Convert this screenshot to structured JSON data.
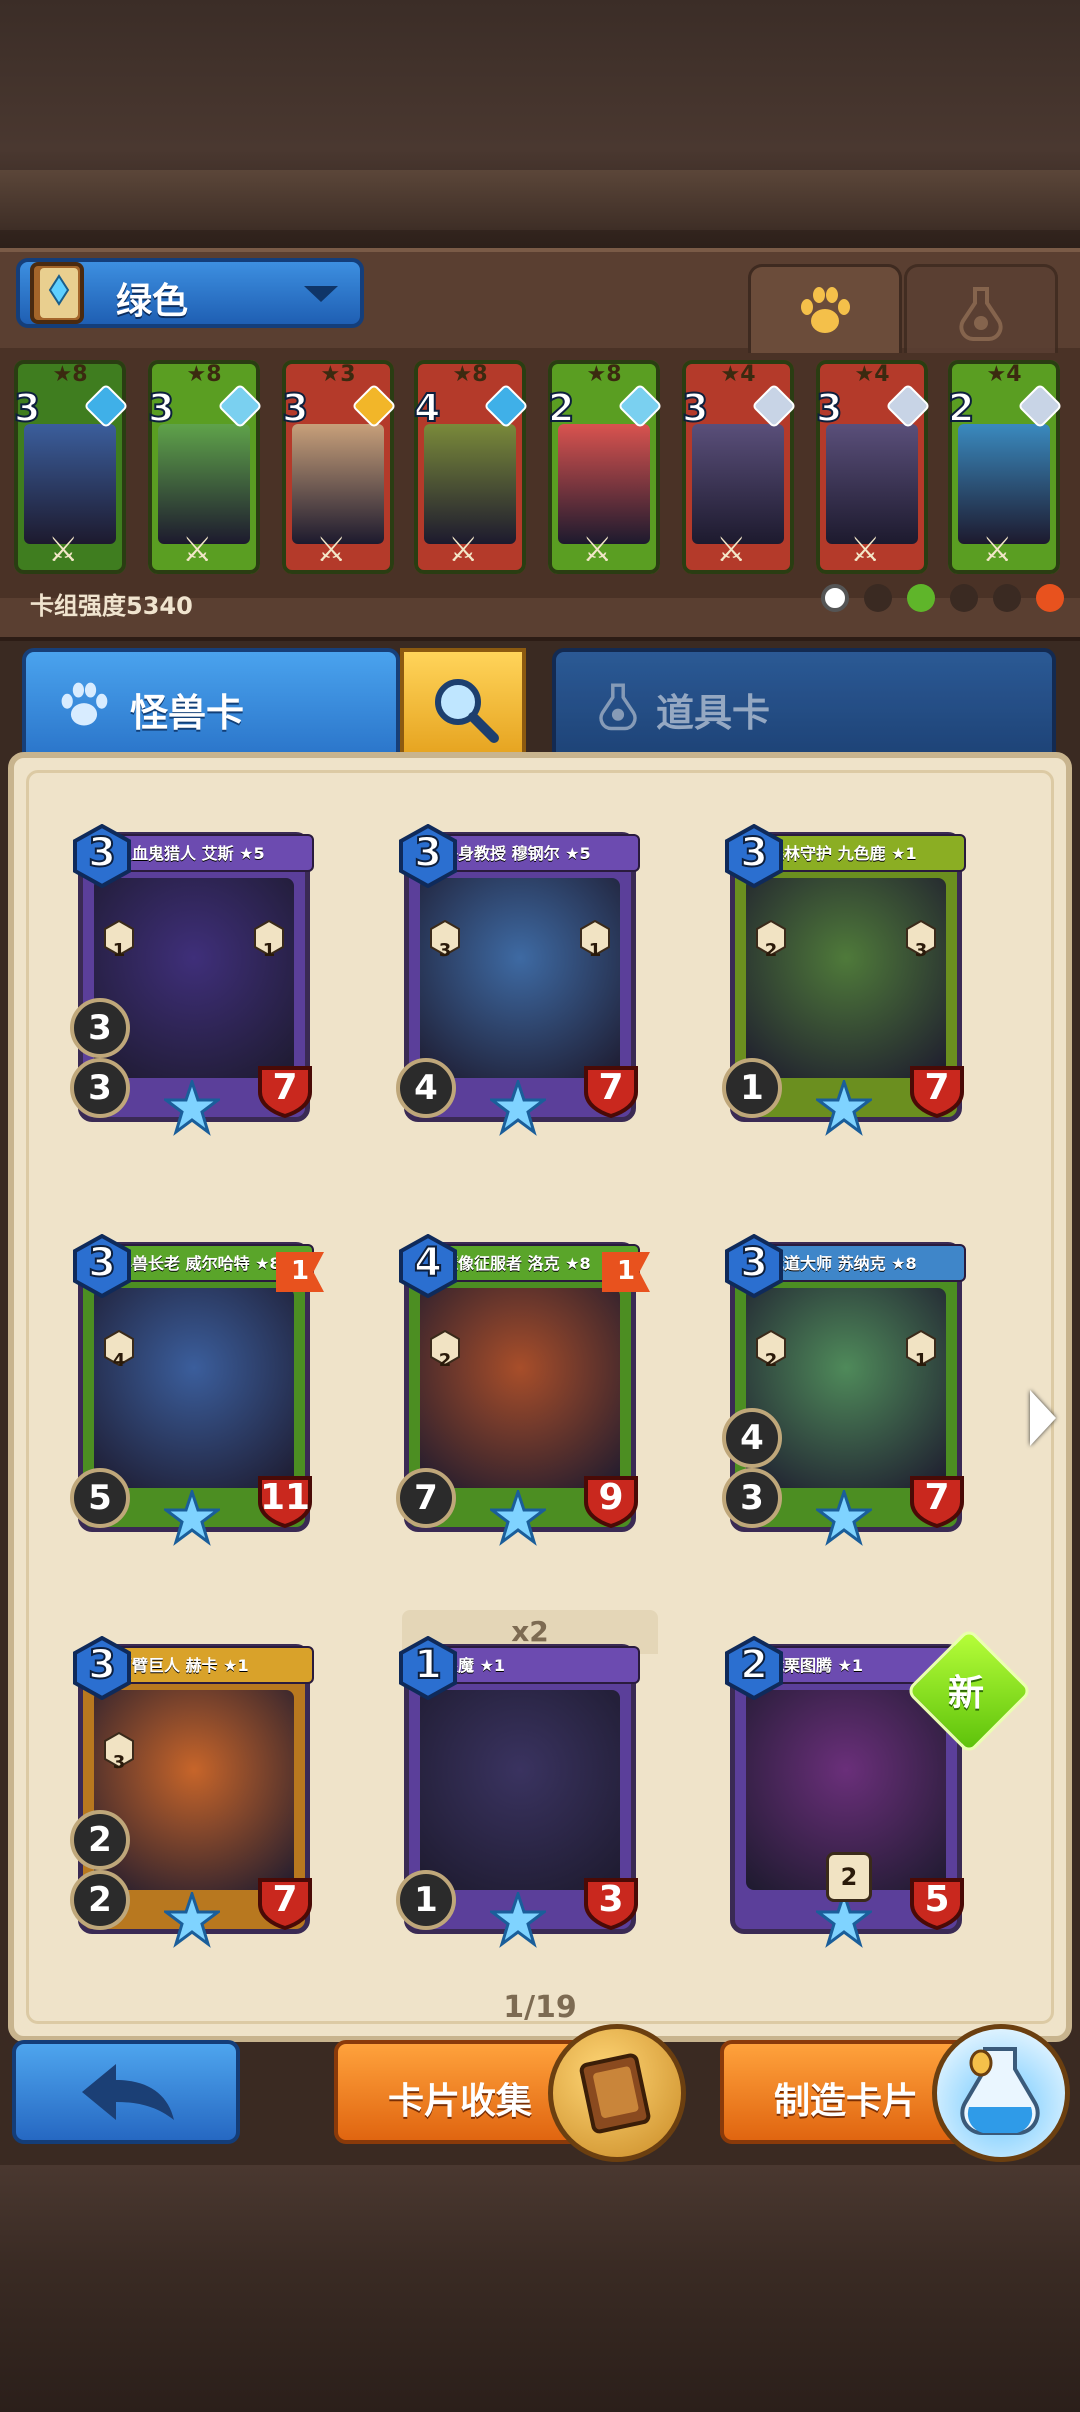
{
  "deck": {
    "selected_name": "绿色",
    "power_label": "卡组强度5340",
    "tabs": [
      "paw-icon",
      "potion-icon"
    ],
    "cards": [
      {
        "stars": "★8",
        "cost": "3",
        "gem_color": "#3fb0e8",
        "frame_color": "#3f7d1f",
        "art_color": "#3b5e9c"
      },
      {
        "stars": "★8",
        "cost": "3",
        "gem_color": "#7ad0f0",
        "frame_color": "#5a9e22",
        "art_color": "#5fa34a"
      },
      {
        "stars": "★3",
        "cost": "3",
        "gem_color": "#f2b629",
        "frame_color": "#b43a2a",
        "art_color": "#c8a07a"
      },
      {
        "stars": "★8",
        "cost": "4",
        "gem_color": "#3fb0e8",
        "frame_color": "#b43a2a",
        "art_color": "#7a8a3a"
      },
      {
        "stars": "★8",
        "cost": "2",
        "gem_color": "#7ad0f0",
        "frame_color": "#5a9e22",
        "art_color": "#d9534f"
      },
      {
        "stars": "★4",
        "cost": "3",
        "gem_color": "#c8d4e6",
        "frame_color": "#b43a2a",
        "art_color": "#5a4f7a"
      },
      {
        "stars": "★4",
        "cost": "3",
        "gem_color": "#c8d4e6",
        "frame_color": "#b43a2a",
        "art_color": "#5a4f7a"
      },
      {
        "stars": "★4",
        "cost": "2",
        "gem_color": "#c8d4e6",
        "frame_color": "#5a9e22",
        "art_color": "#3a8abf"
      }
    ]
  },
  "categories": {
    "monster_label": "怪兽卡",
    "items_label": "道具卡"
  },
  "cards": [
    {
      "name": "吸血鬼猎人 艾斯 ★5",
      "cost": "3",
      "attack": "3",
      "attack2": "3",
      "hp": "7",
      "side_left": "1",
      "side_right": "1",
      "banner_color": "#6c4bb0",
      "art_color": "#3f2f7a",
      "body_color": "#5b3f9a"
    },
    {
      "name": "终身教授 穆钢尔 ★5",
      "cost": "3",
      "attack": "4",
      "attack2": "",
      "hp": "7",
      "side_left": "3",
      "side_right": "1",
      "banner_color": "#6c4bb0",
      "art_color": "#3e6aa3",
      "body_color": "#5b3f9a"
    },
    {
      "name": "森林守护 九色鹿 ★1",
      "cost": "3",
      "attack": "1",
      "attack2": "",
      "hp": "7",
      "side_left": "2",
      "side_right": "3",
      "banner_color": "#8bae23",
      "art_color": "#4f7a3a",
      "body_color": "#6b8f1f"
    },
    {
      "name": "异兽长老 威尔哈特 ★8",
      "cost": "3",
      "attack": "5",
      "attack2": "",
      "hp": "11",
      "side_left": "4",
      "side_right": "",
      "banner_color": "#5aa52a",
      "art_color": "#3b5e9c",
      "body_color": "#4c8e22",
      "flag": "1"
    },
    {
      "name": "魔像征服者 洛克 ★8",
      "cost": "4",
      "attack": "7",
      "attack2": "",
      "hp": "9",
      "side_left": "2",
      "side_right": "",
      "banner_color": "#5aa52a",
      "art_color": "#a84e2a",
      "body_color": "#4c8e22",
      "flag": "1"
    },
    {
      "name": "武道大师 苏纳克 ★8",
      "cost": "3",
      "attack": "3",
      "attack2": "4",
      "hp": "7",
      "side_left": "2",
      "side_right": "1",
      "banner_color": "#3f86c9",
      "art_color": "#4f8a5a",
      "body_color": "#4c8e22"
    },
    {
      "name": "百臂巨人 赫卡 ★1",
      "cost": "3",
      "attack": "2",
      "attack2": "2",
      "hp": "7",
      "side_left": "3",
      "side_right": "",
      "banner_color": "#d9a22a",
      "art_color": "#c7652a",
      "body_color": "#b8781f"
    },
    {
      "name": "眼魔 ★1",
      "cost": "1",
      "attack": "1",
      "attack2": "",
      "hp": "3",
      "side_left": "",
      "side_right": "",
      "banner_color": "#6c4bb0",
      "art_color": "#3a3360",
      "body_color": "#5b3f9a"
    },
    {
      "name": "战栗图腾 ★1",
      "cost": "2",
      "attack": "",
      "attack2": "",
      "hp": "5",
      "side_left": "",
      "side_right": "",
      "banner_color": "#6c4bb0",
      "art_color": "#6a2f7a",
      "body_color": "#5b3f9a",
      "bottom_stat": "2"
    }
  ],
  "duplicate_label": "x2",
  "new_badge": "新",
  "page_indicator": "1/19",
  "buttons": {
    "back_icon": "back-arrow-icon",
    "collect_label": "卡片收集",
    "craft_label": "制造卡片"
  }
}
